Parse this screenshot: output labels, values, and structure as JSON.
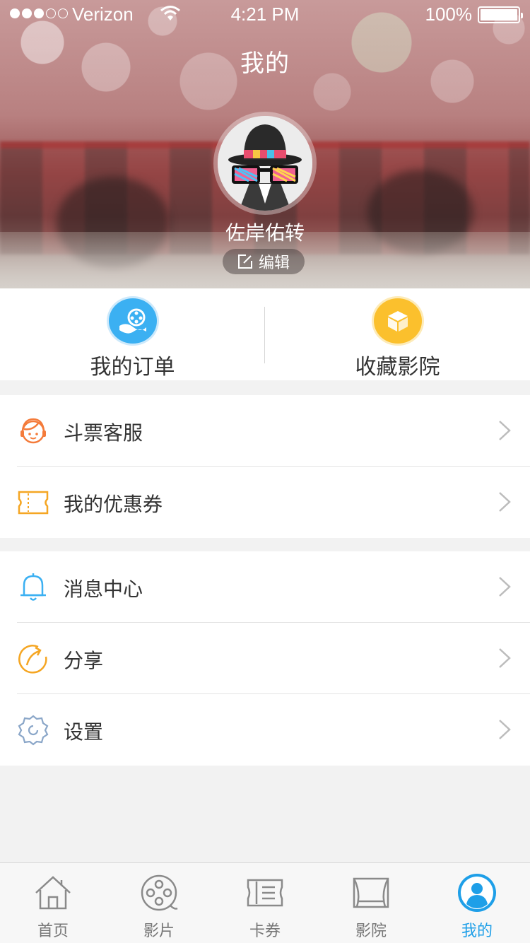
{
  "status_bar": {
    "carrier": "Verizon",
    "time": "4:21 PM",
    "battery": "100%"
  },
  "header": {
    "title": "我的",
    "username": "佐岸佑转",
    "edit_label": "编辑"
  },
  "quick_actions": [
    {
      "label": "我的订单",
      "icon": "film-reel-icon",
      "color": "#3bb0f2"
    },
    {
      "label": "收藏影院",
      "icon": "box-icon",
      "color": "#fbc02d"
    }
  ],
  "menu_group_1": [
    {
      "label": "斗票客服",
      "icon": "customer-service-icon",
      "color": "#f47b3a"
    },
    {
      "label": "我的优惠券",
      "icon": "coupon-icon",
      "color": "#f5a623"
    }
  ],
  "menu_group_2": [
    {
      "label": "消息中心",
      "icon": "bell-icon",
      "color": "#3bb0f2"
    },
    {
      "label": "分享",
      "icon": "share-icon",
      "color": "#f5a623"
    },
    {
      "label": "设置",
      "icon": "gear-icon",
      "color": "#8aa6c8"
    }
  ],
  "tabs": [
    {
      "label": "首页",
      "icon": "home-icon",
      "active": false
    },
    {
      "label": "影片",
      "icon": "film-icon",
      "active": false
    },
    {
      "label": "卡券",
      "icon": "ticket-icon",
      "active": false
    },
    {
      "label": "影院",
      "icon": "cinema-icon",
      "active": false
    },
    {
      "label": "我的",
      "icon": "user-icon",
      "active": true
    }
  ],
  "colors": {
    "accent": "#1e9fe8",
    "tab_inactive": "#777777",
    "background": "#f2f2f2"
  }
}
